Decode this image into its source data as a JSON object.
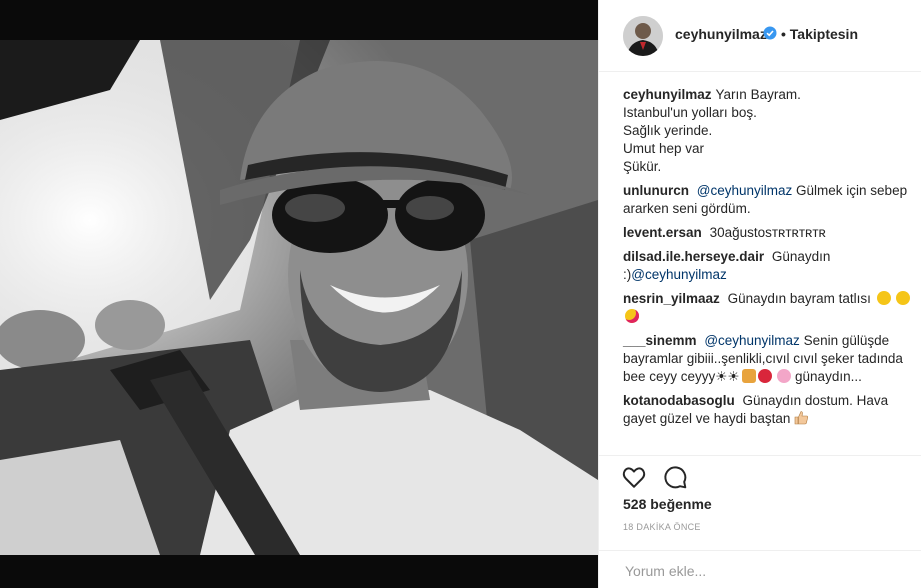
{
  "post": {
    "username": "ceyhunyilmaz",
    "follow_state": "• Takiptesin",
    "caption_lines": [
      "Yarın Bayram.",
      "Istanbul'un yolları boş.",
      "Sağlık yerinde.",
      "Umut hep var",
      "Şükür."
    ]
  },
  "comments": [
    {
      "user": "unlunurcn",
      "mention": "@ceyhunyilmaz",
      "text": "Gülmek için sebep ararken seni gördüm."
    },
    {
      "user": "levent.ersan",
      "text": "30ağustosтʀтʀтʀтʀ"
    },
    {
      "user": "dilsad.ile.herseye.dair",
      "text": "Günaydın :)",
      "mention": "@ceyhunyilmaz"
    },
    {
      "user": "nesrin_yilmaaz",
      "text": "Günaydın bayram tatlısı"
    },
    {
      "user": "___sinemm",
      "mention": "@ceyhunyilmaz",
      "text": "Senin gülüşde bayramlar gibiii..şenlikli,cıvıl cıvıl şeker tadında bee ceyy ceyyy☀☀",
      "text2": "günaydın..."
    },
    {
      "user": "kotanodabasoglu",
      "text": "Günaydın dostum. Hava gayet güzel ve haydi baştan"
    }
  ],
  "likes": "528 beğenme",
  "time": "18 DAKİKA ÖNCE",
  "comment_input": {
    "placeholder": "Yorum ekle..."
  },
  "icons": [
    "verified-badge-icon",
    "heart-icon",
    "comment-icon",
    "thumbs-up-icon"
  ],
  "colors": {
    "verified": "#3897f0",
    "mention": "#003569",
    "text": "#262626",
    "muted": "#999999"
  }
}
